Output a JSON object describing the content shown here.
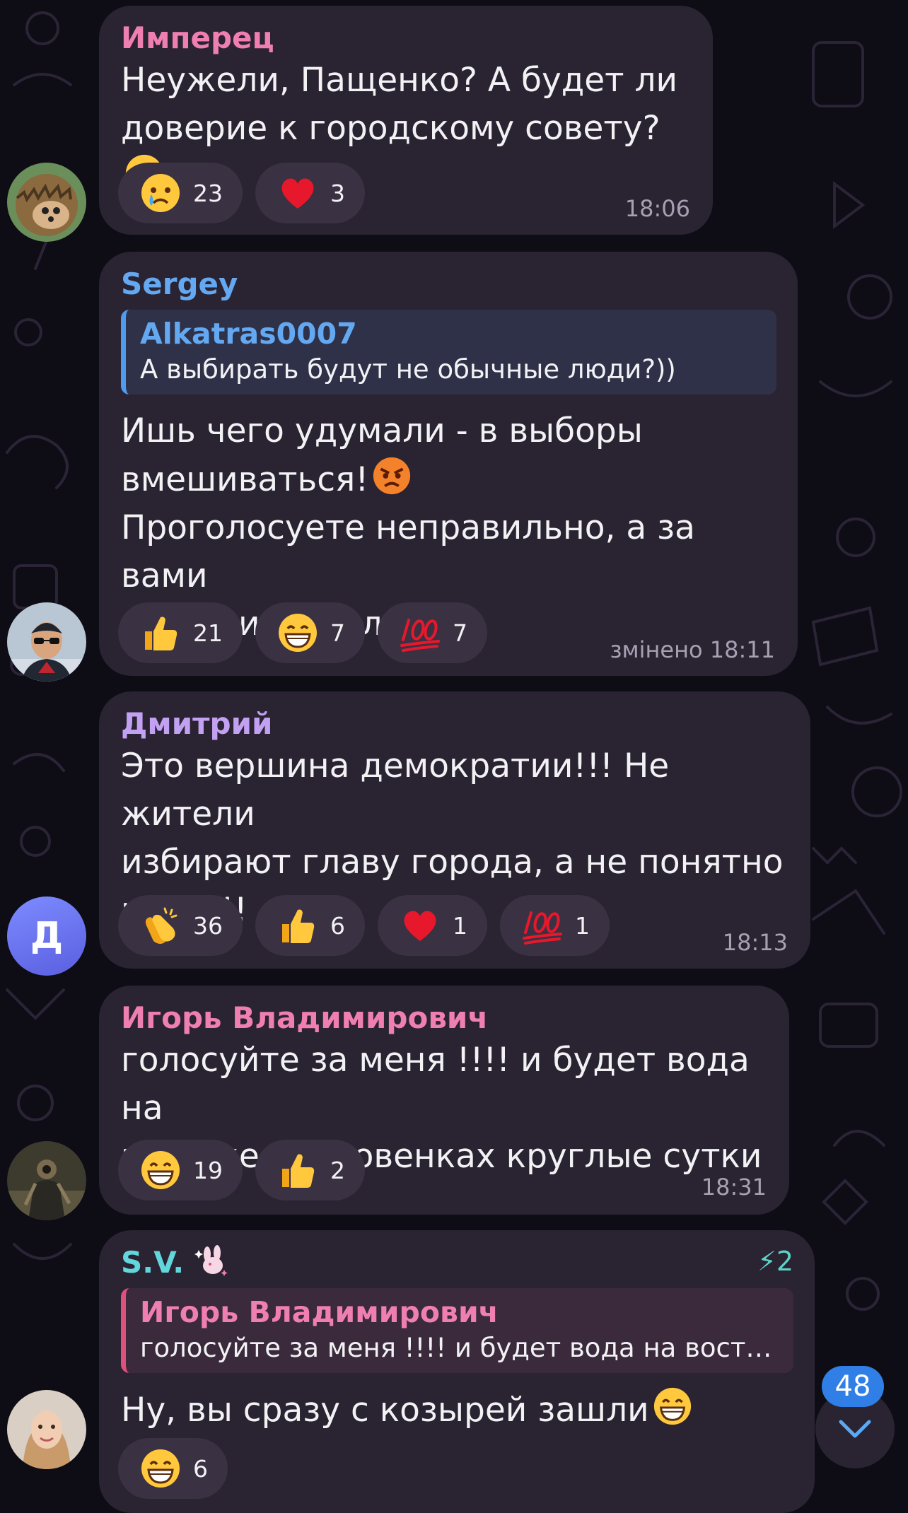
{
  "colors": {
    "background": "#0e0c14",
    "bubble": "#2a2331",
    "reaction_chip": "#3a3142",
    "author_pink": "#f07fb1",
    "author_blue": "#63a8f0",
    "author_violet": "#c3a1f2",
    "author_cyan": "#63d6dc",
    "time": "#a7a0b3",
    "unread_badge": "#2f7fe6"
  },
  "messages": [
    {
      "author": "Имперец",
      "text": "Неужели, Пащенко? А будет ли\nдоверие к городскому совету?",
      "trailing_emoji": "smiling-face",
      "reactions": [
        {
          "icon": "crying-face",
          "count": "23"
        },
        {
          "icon": "red-heart",
          "count": "3"
        }
      ],
      "time": "18:06",
      "avatar": "hedgehog-avatar"
    },
    {
      "author": "Sergey",
      "reply": {
        "author": "Alkatras0007",
        "text": "А выбирать будут не обычные люди?))"
      },
      "text_line1": "Ишь чего удумали - в выборы\nвмешиваться!",
      "trailing_emoji": "angry-face",
      "text_line2": "Проголосуете неправильно, а за вами\nпотом исправлять!",
      "reactions": [
        {
          "icon": "thumbs-up",
          "count": "21"
        },
        {
          "icon": "grinning-face",
          "count": "7"
        },
        {
          "icon": "hundred-points",
          "count": "7"
        }
      ],
      "time": "змінено 18:11",
      "avatar": "man-sunglasses-avatar"
    },
    {
      "author": "Дмитрий",
      "text": "Это вершина демократии!!! Не жители\nизбирают главу города, а не понятно\nкто!!!!!",
      "reactions": [
        {
          "icon": "clapping-hands",
          "count": "36"
        },
        {
          "icon": "thumbs-up",
          "count": "6"
        },
        {
          "icon": "red-heart",
          "count": "1"
        },
        {
          "icon": "hundred-points",
          "count": "1"
        }
      ],
      "time": "18:13",
      "avatar_letter": "Д"
    },
    {
      "author": "Игорь Владимирович",
      "text": "голосуйте за меня !!!! и будет вода на\nвостоке и в ровенках круглые сутки",
      "reactions": [
        {
          "icon": "grinning-face",
          "count": "19"
        },
        {
          "icon": "thumbs-up",
          "count": "2"
        }
      ],
      "time": "18:31",
      "avatar": "armored-warrior-avatar"
    },
    {
      "author": "S.V.",
      "author_badge": "sparkle-bunny-icon",
      "boost_count": "2",
      "reply": {
        "author": "Игорь Владимирович",
        "text": "голосуйте за меня !!!! и будет вода на вост…"
      },
      "text": "Ну, вы сразу с козырей зашли",
      "trailing_emoji": "grinning-face",
      "reactions": [
        {
          "icon": "grinning-face",
          "count": "6"
        }
      ],
      "avatar": "woman-avatar"
    }
  ],
  "unread_count": "48"
}
